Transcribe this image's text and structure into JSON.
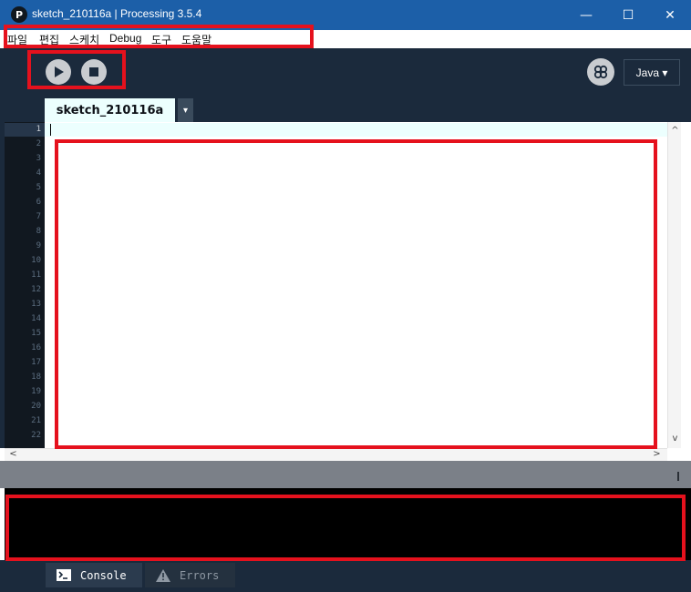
{
  "window": {
    "title": "sketch_210116a | Processing 3.5.4",
    "logo_letter": "P",
    "controls": {
      "minimize": "—",
      "maximize": "☐",
      "close": "✕"
    }
  },
  "menu": {
    "items": [
      "파일",
      "편집",
      "스케치",
      "Debug",
      "도구",
      "도움말"
    ]
  },
  "toolbar": {
    "run_icon": "play-icon",
    "stop_icon": "stop-icon",
    "debug_icon": "butterfly-debug-icon",
    "mode_label": "Java ▾"
  },
  "tabs": [
    {
      "label": "sketch_210116a"
    }
  ],
  "tab_menu_glyph": "▾",
  "editor": {
    "line_numbers": [
      "1",
      "2",
      "3",
      "4",
      "5",
      "6",
      "7",
      "8",
      "9",
      "10",
      "11",
      "12",
      "13",
      "14",
      "15",
      "16",
      "17",
      "18",
      "19",
      "20",
      "21",
      "22"
    ],
    "active_line": "1",
    "content": ""
  },
  "scroll": {
    "up": "^",
    "down": "v",
    "left": "<",
    "right": ">"
  },
  "bottom_tabs": [
    {
      "label": "Console",
      "icon": "terminal-icon"
    },
    {
      "label": "Errors",
      "icon": "warning-icon"
    }
  ],
  "annotation_color": "#e5111d"
}
